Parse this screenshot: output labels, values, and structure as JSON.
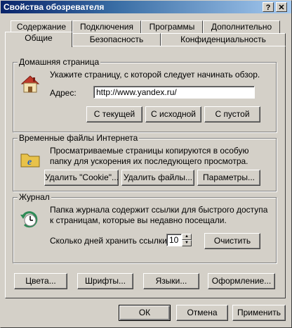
{
  "window": {
    "title": "Свойства обозревателя",
    "help_glyph": "?",
    "close_glyph": "✕"
  },
  "tabs_row1": [
    "Содержание",
    "Подключения",
    "Программы",
    "Дополнительно"
  ],
  "tabs_row2": [
    "Общие",
    "Безопасность",
    "Конфиденциальность"
  ],
  "home": {
    "legend": "Домашняя страница",
    "desc": "Укажите страницу, с которой следует начинать обзор.",
    "address_label": "Адрес:",
    "address_value": "http://www.yandex.ru/",
    "btn_current": "С текущей",
    "btn_default": "С исходной",
    "btn_blank": "С пустой"
  },
  "temp": {
    "legend": "Временные файлы Интернета",
    "desc_line1": "Просматриваемые страницы копируются в особую",
    "desc_line2": "папку для ускорения их последующего просмотра.",
    "btn_cookies": "Удалить \"Cookie\"...",
    "btn_files": "Удалить файлы...",
    "btn_settings": "Параметры..."
  },
  "history": {
    "legend": "Журнал",
    "desc_line1": "Папка журнала содержит ссылки для быстрого доступа",
    "desc_line2": "к страницам, которые вы недавно посещали.",
    "days_label": "Сколько дней хранить ссылки:",
    "days_value": "10",
    "btn_clear": "Очистить"
  },
  "bottom": {
    "btn_colors": "Цвета...",
    "btn_fonts": "Шрифты...",
    "btn_languages": "Языки...",
    "btn_accessibility": "Оформление..."
  },
  "footer": {
    "btn_ok": "ОК",
    "btn_cancel": "Отмена",
    "btn_apply": "Применить"
  },
  "colors": {
    "titlebar": "#0a246a",
    "face": "#d4d0c8"
  }
}
